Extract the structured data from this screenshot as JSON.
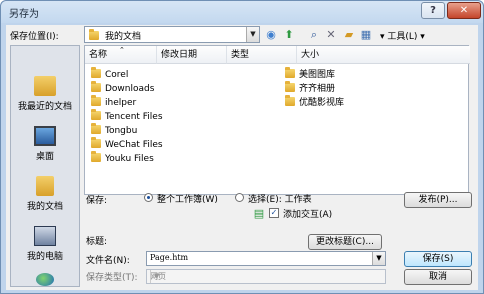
{
  "window": {
    "title": "另存为"
  },
  "titlebar_buttons": {
    "help": "?",
    "close": "✕"
  },
  "location": {
    "label": "保存位置(I):",
    "value": "我的文档"
  },
  "toolbar": {
    "tools_label": "工具(L)"
  },
  "places": [
    {
      "label": "我最近的文档",
      "icon": "recent-documents-icon"
    },
    {
      "label": "桌面",
      "icon": "desktop-icon"
    },
    {
      "label": "我的文档",
      "icon": "my-documents-icon"
    },
    {
      "label": "我的电脑",
      "icon": "my-computer-icon"
    }
  ],
  "columns": {
    "name": "名称",
    "modified": "修改日期",
    "type": "类型",
    "size": "大小"
  },
  "files_left": [
    "Corel",
    "Downloads",
    "ihelper",
    "Tencent Files",
    "Tongbu",
    "WeChat Files",
    "Youku Files"
  ],
  "files_right": [
    "美图图库",
    "齐齐相册",
    "优酷影视库"
  ],
  "save": {
    "label": "保存:",
    "option_workbook": "整个工作簿(W)",
    "option_selection": "选择(E): 工作表",
    "publish": "发布(P)...",
    "add_interactive": "添加交互(A)"
  },
  "title_field": {
    "label": "标题:",
    "change_button": "更改标题(C)..."
  },
  "filename": {
    "label": "文件名(N):",
    "value": "Page.htm"
  },
  "filetype": {
    "label": "保存类型(T):",
    "value": "网页"
  },
  "buttons": {
    "save": "保存(S)",
    "cancel": "取消"
  }
}
